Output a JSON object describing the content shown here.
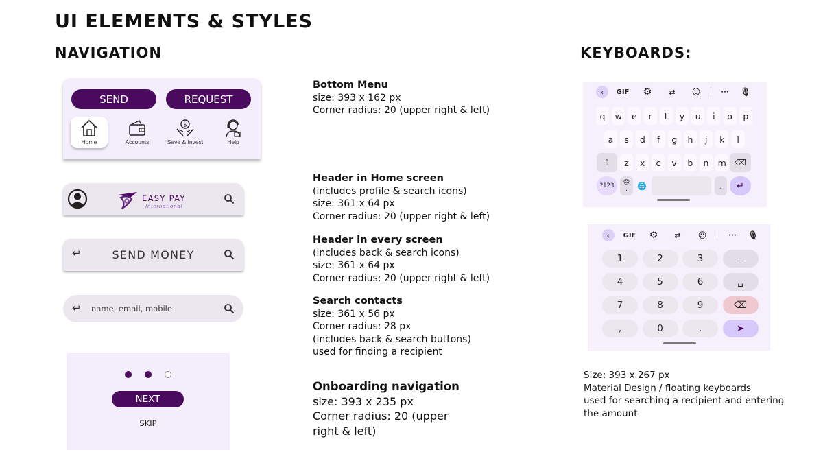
{
  "titles": {
    "main": "UI ELEMENTS & STYLES",
    "navigation": "NAVIGATION",
    "keyboards": "KEYBOARDS:"
  },
  "bottom_menu": {
    "send": "SEND",
    "request": "REQUEST",
    "items": [
      {
        "label": "Home",
        "icon": "home-icon",
        "active": true
      },
      {
        "label": "Accounts",
        "icon": "wallet-icon",
        "active": false
      },
      {
        "label": "Save & Invest",
        "icon": "money-hands-icon",
        "active": false
      },
      {
        "label": "Help",
        "icon": "support-agent-icon",
        "active": false
      }
    ]
  },
  "home_header": {
    "logo_main": "EASY PAY",
    "logo_sub": "International"
  },
  "send_header": {
    "title": "SEND MONEY"
  },
  "search_contacts": {
    "placeholder": "name, email, mobile"
  },
  "onboarding": {
    "next": "NEXT",
    "skip": "SKIP",
    "dots": [
      "filled",
      "filled",
      "empty"
    ]
  },
  "descriptions": {
    "bottom_menu": {
      "title": "Bottom Menu",
      "lines": [
        "size: 393 x 162 px",
        "Corner radius: 20 (upper right & left)"
      ]
    },
    "home_header": {
      "title": "Header in Home screen",
      "lines": [
        "(includes profile & search icons)",
        "size: 361 x 64 px",
        "Corner radius: 20 (upper right & left)"
      ]
    },
    "every_header": {
      "title": "Header in every screen",
      "lines": [
        "(includes back & search icons)",
        "size: 361 x 64 px",
        "Corner radius: 20 (upper right & left)"
      ]
    },
    "search_contacts": {
      "title": "Search contacts",
      "lines": [
        "size: 361 x 56 px",
        "Corner radius: 28 px",
        "(includes back & search buttons)",
        "used for finding a recipient"
      ]
    },
    "onboarding": {
      "title": "Onboarding navigation",
      "lines": [
        "size: 393 x 235 px",
        "Corner radius: 20 (upper",
        "right & left)"
      ]
    }
  },
  "keyboards_desc": [
    "Size: 393 x 267 px",
    "Material Design / floating keyboards",
    "used for searching a recipient and entering",
    "the amount"
  ],
  "keyboard_toolbar": {
    "gif": "GIF",
    "more": "···"
  },
  "keyboard_letters": {
    "row1": [
      "q",
      "w",
      "e",
      "r",
      "t",
      "y",
      "u",
      "i",
      "o",
      "p"
    ],
    "row2": [
      "a",
      "s",
      "d",
      "f",
      "g",
      "h",
      "j",
      "k",
      "l"
    ],
    "row3": [
      "z",
      "x",
      "c",
      "v",
      "b",
      "n",
      "m"
    ],
    "sym": "?123",
    "comma": ",",
    "period": "."
  },
  "keyboard_numbers": {
    "rows": [
      [
        "1",
        "2",
        "3",
        "-"
      ],
      [
        "4",
        "5",
        "6",
        "␣"
      ],
      [
        "7",
        "8",
        "9",
        "⌫"
      ],
      [
        ",",
        "0",
        ".",
        "➤"
      ]
    ]
  },
  "colors": {
    "brand": "#4a0a5e",
    "panel": "#f3edfc",
    "bar": "#ece6ee",
    "delete_key": "#f0c8d0",
    "action_key": "#d6c8f8"
  }
}
